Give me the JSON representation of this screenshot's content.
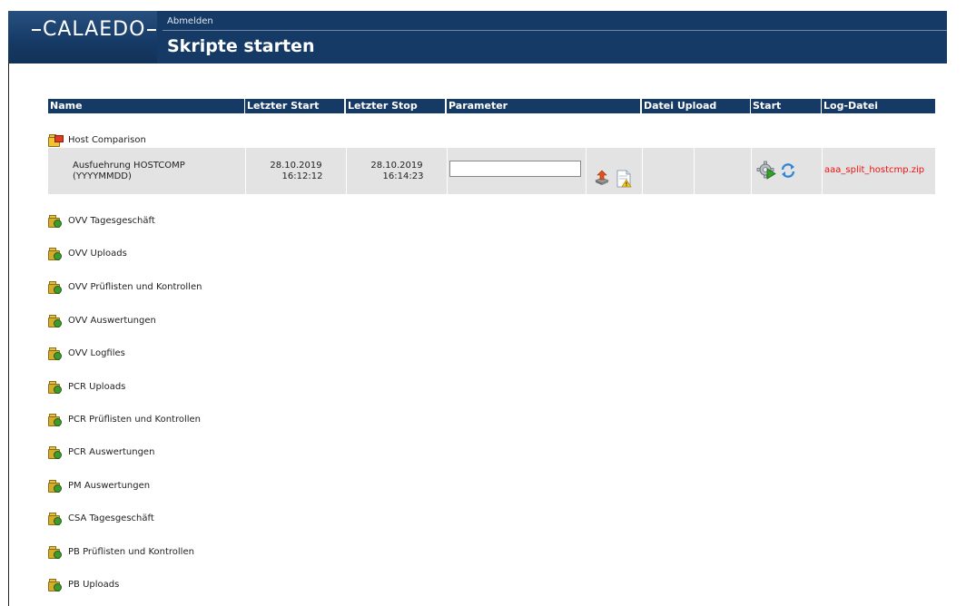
{
  "header": {
    "brand": "CALAEDO",
    "logout": "Abmelden",
    "title": "Skripte starten"
  },
  "table": {
    "columns": [
      "Name",
      "Letzter Start",
      "Letzter Stop",
      "Parameter",
      "Datei Upload",
      "Start",
      "Log-Datei"
    ]
  },
  "groups": [
    {
      "label": "Host Comparison",
      "expanded": true
    },
    {
      "label": "OVV Tagesgeschäft"
    },
    {
      "label": "OVV Uploads"
    },
    {
      "label": "OVV Prüflisten und Kontrollen"
    },
    {
      "label": "OVV Auswertungen"
    },
    {
      "label": "OVV Logfiles"
    },
    {
      "label": "PCR Uploads"
    },
    {
      "label": "PCR Prüflisten und Kontrollen"
    },
    {
      "label": "PCR Auswertungen"
    },
    {
      "label": "PM Auswertungen"
    },
    {
      "label": "CSA Tagesgeschäft"
    },
    {
      "label": "PB Prüflisten und Kontrollen"
    },
    {
      "label": "PB Uploads"
    }
  ],
  "script": {
    "name_line1": "Ausfuehrung HOSTCOMP",
    "name_line2": "(YYYYMMDD)",
    "last_start_date": "28.10.2019",
    "last_start_time": "16:12:12",
    "last_stop_date": "28.10.2019",
    "last_stop_time": "16:14:23",
    "parameter_value": "",
    "log_file": "aaa_split_hostcmp.zip"
  },
  "icons": {
    "folder_closed": "folder-icon",
    "folder_open": "open-folder-icon",
    "upload": "upload-icon",
    "warning_doc": "warning-document-icon",
    "start": "gear-play-icon",
    "refresh": "refresh-icon"
  },
  "colors": {
    "header_bg": "#163a66",
    "row_bg": "#e3e3e3",
    "log_link": "#ee1111"
  }
}
